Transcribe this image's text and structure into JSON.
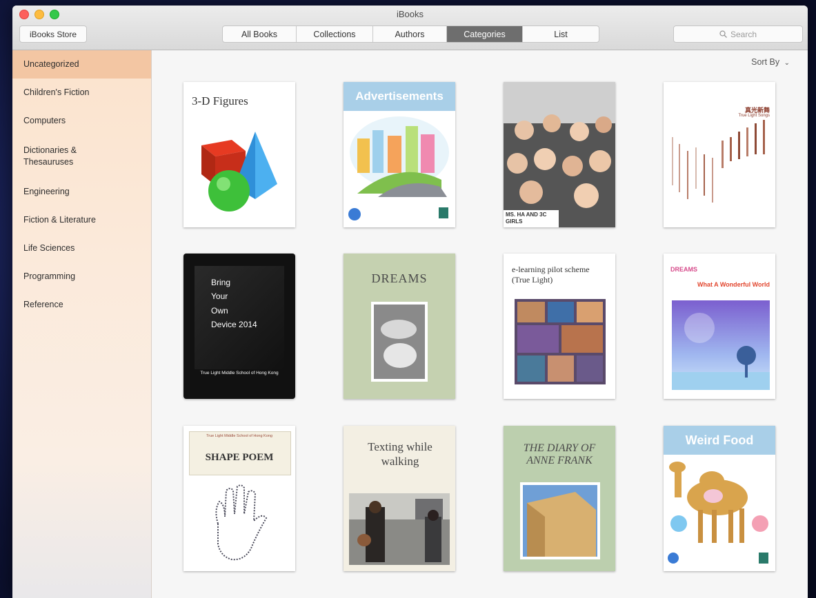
{
  "window": {
    "title": "iBooks"
  },
  "toolbar": {
    "store_label": "iBooks Store",
    "segments": [
      "All Books",
      "Collections",
      "Authors",
      "Categories",
      "List"
    ],
    "active_segment": "Categories",
    "search_placeholder": "Search"
  },
  "sidebar": {
    "items": [
      {
        "label": "Uncategorized"
      },
      {
        "label": "Children's Fiction"
      },
      {
        "label": "Computers"
      },
      {
        "label": "Dictionaries & Thesauruses"
      },
      {
        "label": "Engineering"
      },
      {
        "label": "Fiction & Literature"
      },
      {
        "label": "Life Sciences"
      },
      {
        "label": "Programming"
      },
      {
        "label": "Reference"
      }
    ]
  },
  "content": {
    "sort_label": "Sort By"
  },
  "books": [
    {
      "title": "3-D Figures"
    },
    {
      "title": "Advertisements"
    },
    {
      "title": "MS. HA AND 3C GIRLS"
    },
    {
      "title": "真光新舞",
      "subtitle": "True Light Songs"
    },
    {
      "title_lines": [
        "Bring",
        "Your",
        "Own",
        "Device 2014"
      ],
      "subtitle": "True Light Middle School of Hong Kong"
    },
    {
      "title": "DREAMS"
    },
    {
      "title": "e-learning pilot scheme (True Light)"
    },
    {
      "title": "DREAMS",
      "subtitle": "What A Wonderful World"
    },
    {
      "title": "SHAPE POEM",
      "subtitle": "True Light Middle School of Hong Kong"
    },
    {
      "title": "Texting while walking"
    },
    {
      "title": "THE DIARY OF ANNE FRANK"
    },
    {
      "title": "Weird Food"
    }
  ],
  "colors": {
    "active_segment": "#6e6e6e",
    "sidebar_selected": "#f3c6a3",
    "banner_blue": "#a9cfe8"
  }
}
